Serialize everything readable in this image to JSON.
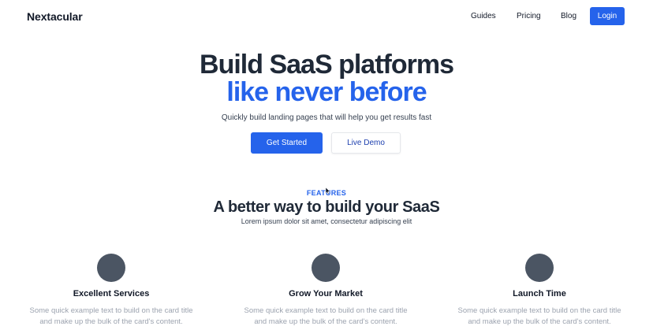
{
  "header": {
    "brand": "Nextacular",
    "nav": [
      "Guides",
      "Pricing",
      "Blog"
    ],
    "login_label": "Login"
  },
  "hero": {
    "title_line1": "Build SaaS platforms",
    "title_line2": "like never before",
    "subtitle": "Quickly build landing pages that will help you get results fast",
    "primary_cta": "Get Started",
    "secondary_cta": "Live Demo"
  },
  "features": {
    "label": "FEATURES",
    "title": "A better way to build your SaaS",
    "subtitle": "Lorem ipsum dolor sit amet, consectetur adipiscing elit",
    "cards": [
      {
        "title": "Excellent Services",
        "text": "Some quick example text to build on the card title and make up the bulk of the card's content."
      },
      {
        "title": "Grow Your Market",
        "text": "Some quick example text to build on the card title and make up the bulk of the card's content."
      },
      {
        "title": "Launch Time",
        "text": "Some quick example text to build on the card title and make up the bulk of the card's content."
      }
    ]
  },
  "colors": {
    "accent": "#2563eb",
    "heading": "#1f2937",
    "muted_text": "#9ca3af",
    "card_icon": "#4b5563"
  }
}
